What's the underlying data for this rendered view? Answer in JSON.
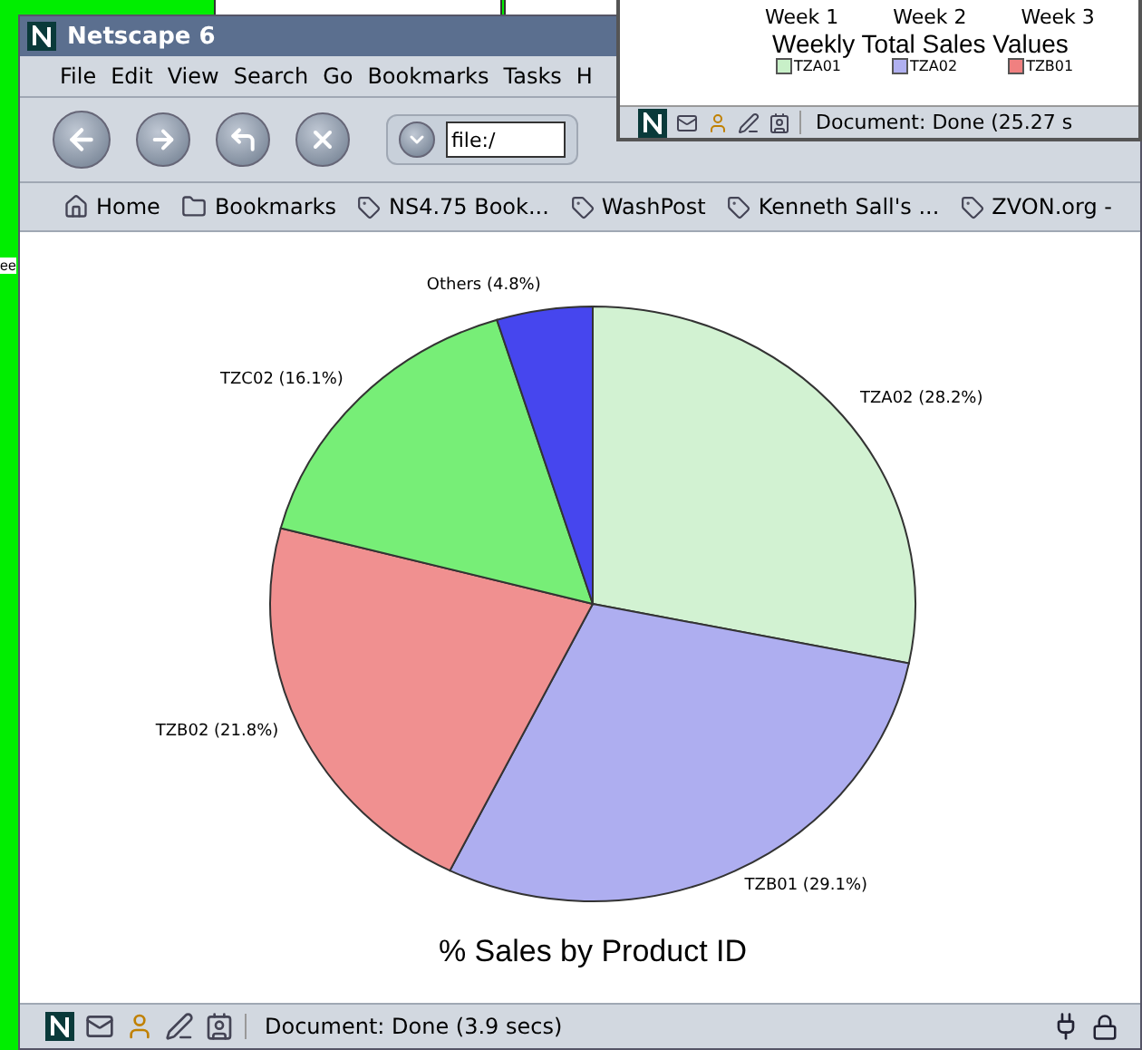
{
  "desktop": {
    "text_fragment": "ee"
  },
  "back_window": {
    "week_labels": [
      "Week 1",
      "Week 2",
      "Week 3"
    ],
    "chart_title": "Weekly Total Sales Values",
    "legend": [
      {
        "label": "TZA01",
        "color": "#c8f0c8"
      },
      {
        "label": "TZA02",
        "color": "#b0b0f0"
      },
      {
        "label": "TZB01",
        "color": "#f08080"
      }
    ],
    "status": "Document: Done (25.27 s"
  },
  "window": {
    "title": "Netscape 6"
  },
  "menu": [
    "File",
    "Edit",
    "View",
    "Search",
    "Go",
    "Bookmarks",
    "Tasks",
    "H"
  ],
  "address": {
    "value": "file:/"
  },
  "personal_toolbar": [
    {
      "label": "Home",
      "kind": "home"
    },
    {
      "label": "Bookmarks",
      "kind": "folder"
    },
    {
      "label": "NS4.75 Book...",
      "kind": "link"
    },
    {
      "label": "WashPost",
      "kind": "link"
    },
    {
      "label": "Kenneth Sall's ...",
      "kind": "link"
    },
    {
      "label": "ZVON.org -",
      "kind": "link"
    }
  ],
  "content": {
    "chart_data": {
      "type": "pie",
      "title": "% Sales by Product ID",
      "values": [
        28.2,
        29.1,
        21.8,
        16.1,
        4.8
      ],
      "colors": [
        "#d2f2d2",
        "#aeaef0",
        "#f09090",
        "#77ee77",
        "#4646ee"
      ],
      "value_labels": [
        "TZA02 (28.2%)",
        "TZB01 (29.1%)",
        "TZB02 (21.8%)",
        "TZC02 (16.1%)",
        "Others (4.8%)"
      ]
    }
  },
  "status_bar": {
    "text": "Document: Done (3.9 secs)"
  }
}
